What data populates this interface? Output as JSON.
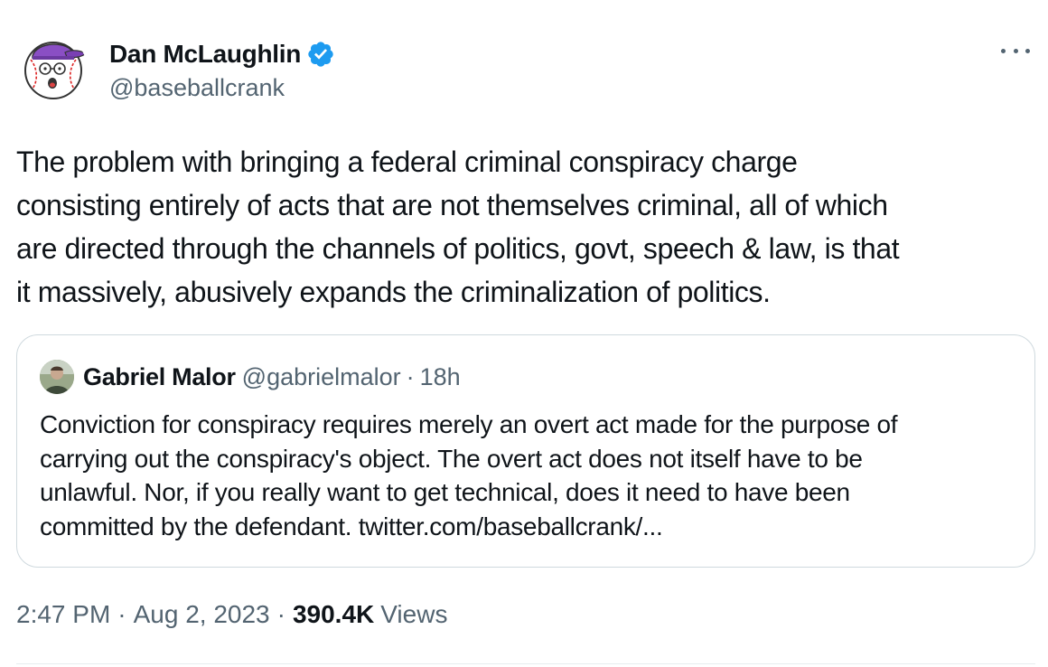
{
  "author": {
    "name": "Dan McLaughlin",
    "handle": "@baseballcrank",
    "verified": true,
    "avatar_icon": "cartoon-baseball-avatar"
  },
  "tweet": {
    "text": "The problem with bringing a federal criminal conspiracy charge\nconsisting entirely of acts that are not themselves criminal, all of which\nare directed through the channels of politics, govt, speech & law, is that\nit massively, abusively expands the criminalization of politics."
  },
  "quoted": {
    "name": "Gabriel Malor",
    "handle": "@gabrielmalor",
    "separator": "·",
    "time": "18h",
    "text": "Conviction for conspiracy requires merely an overt act made for the purpose of\ncarrying out the conspiracy's object. The overt act does not itself have to be\nunlawful. Nor, if you really want to get technical, does it need to have been\ncommitted by the defendant. twitter.com/baseballcrank/..."
  },
  "meta": {
    "time": "2:47 PM",
    "separator": "·",
    "date": "Aug 2, 2023",
    "views_count": "390.4K",
    "views_label": "Views"
  },
  "colors": {
    "text": "#0f1419",
    "secondary": "#536471",
    "verified_blue": "#1d9bf0",
    "border": "#cfd9de"
  }
}
